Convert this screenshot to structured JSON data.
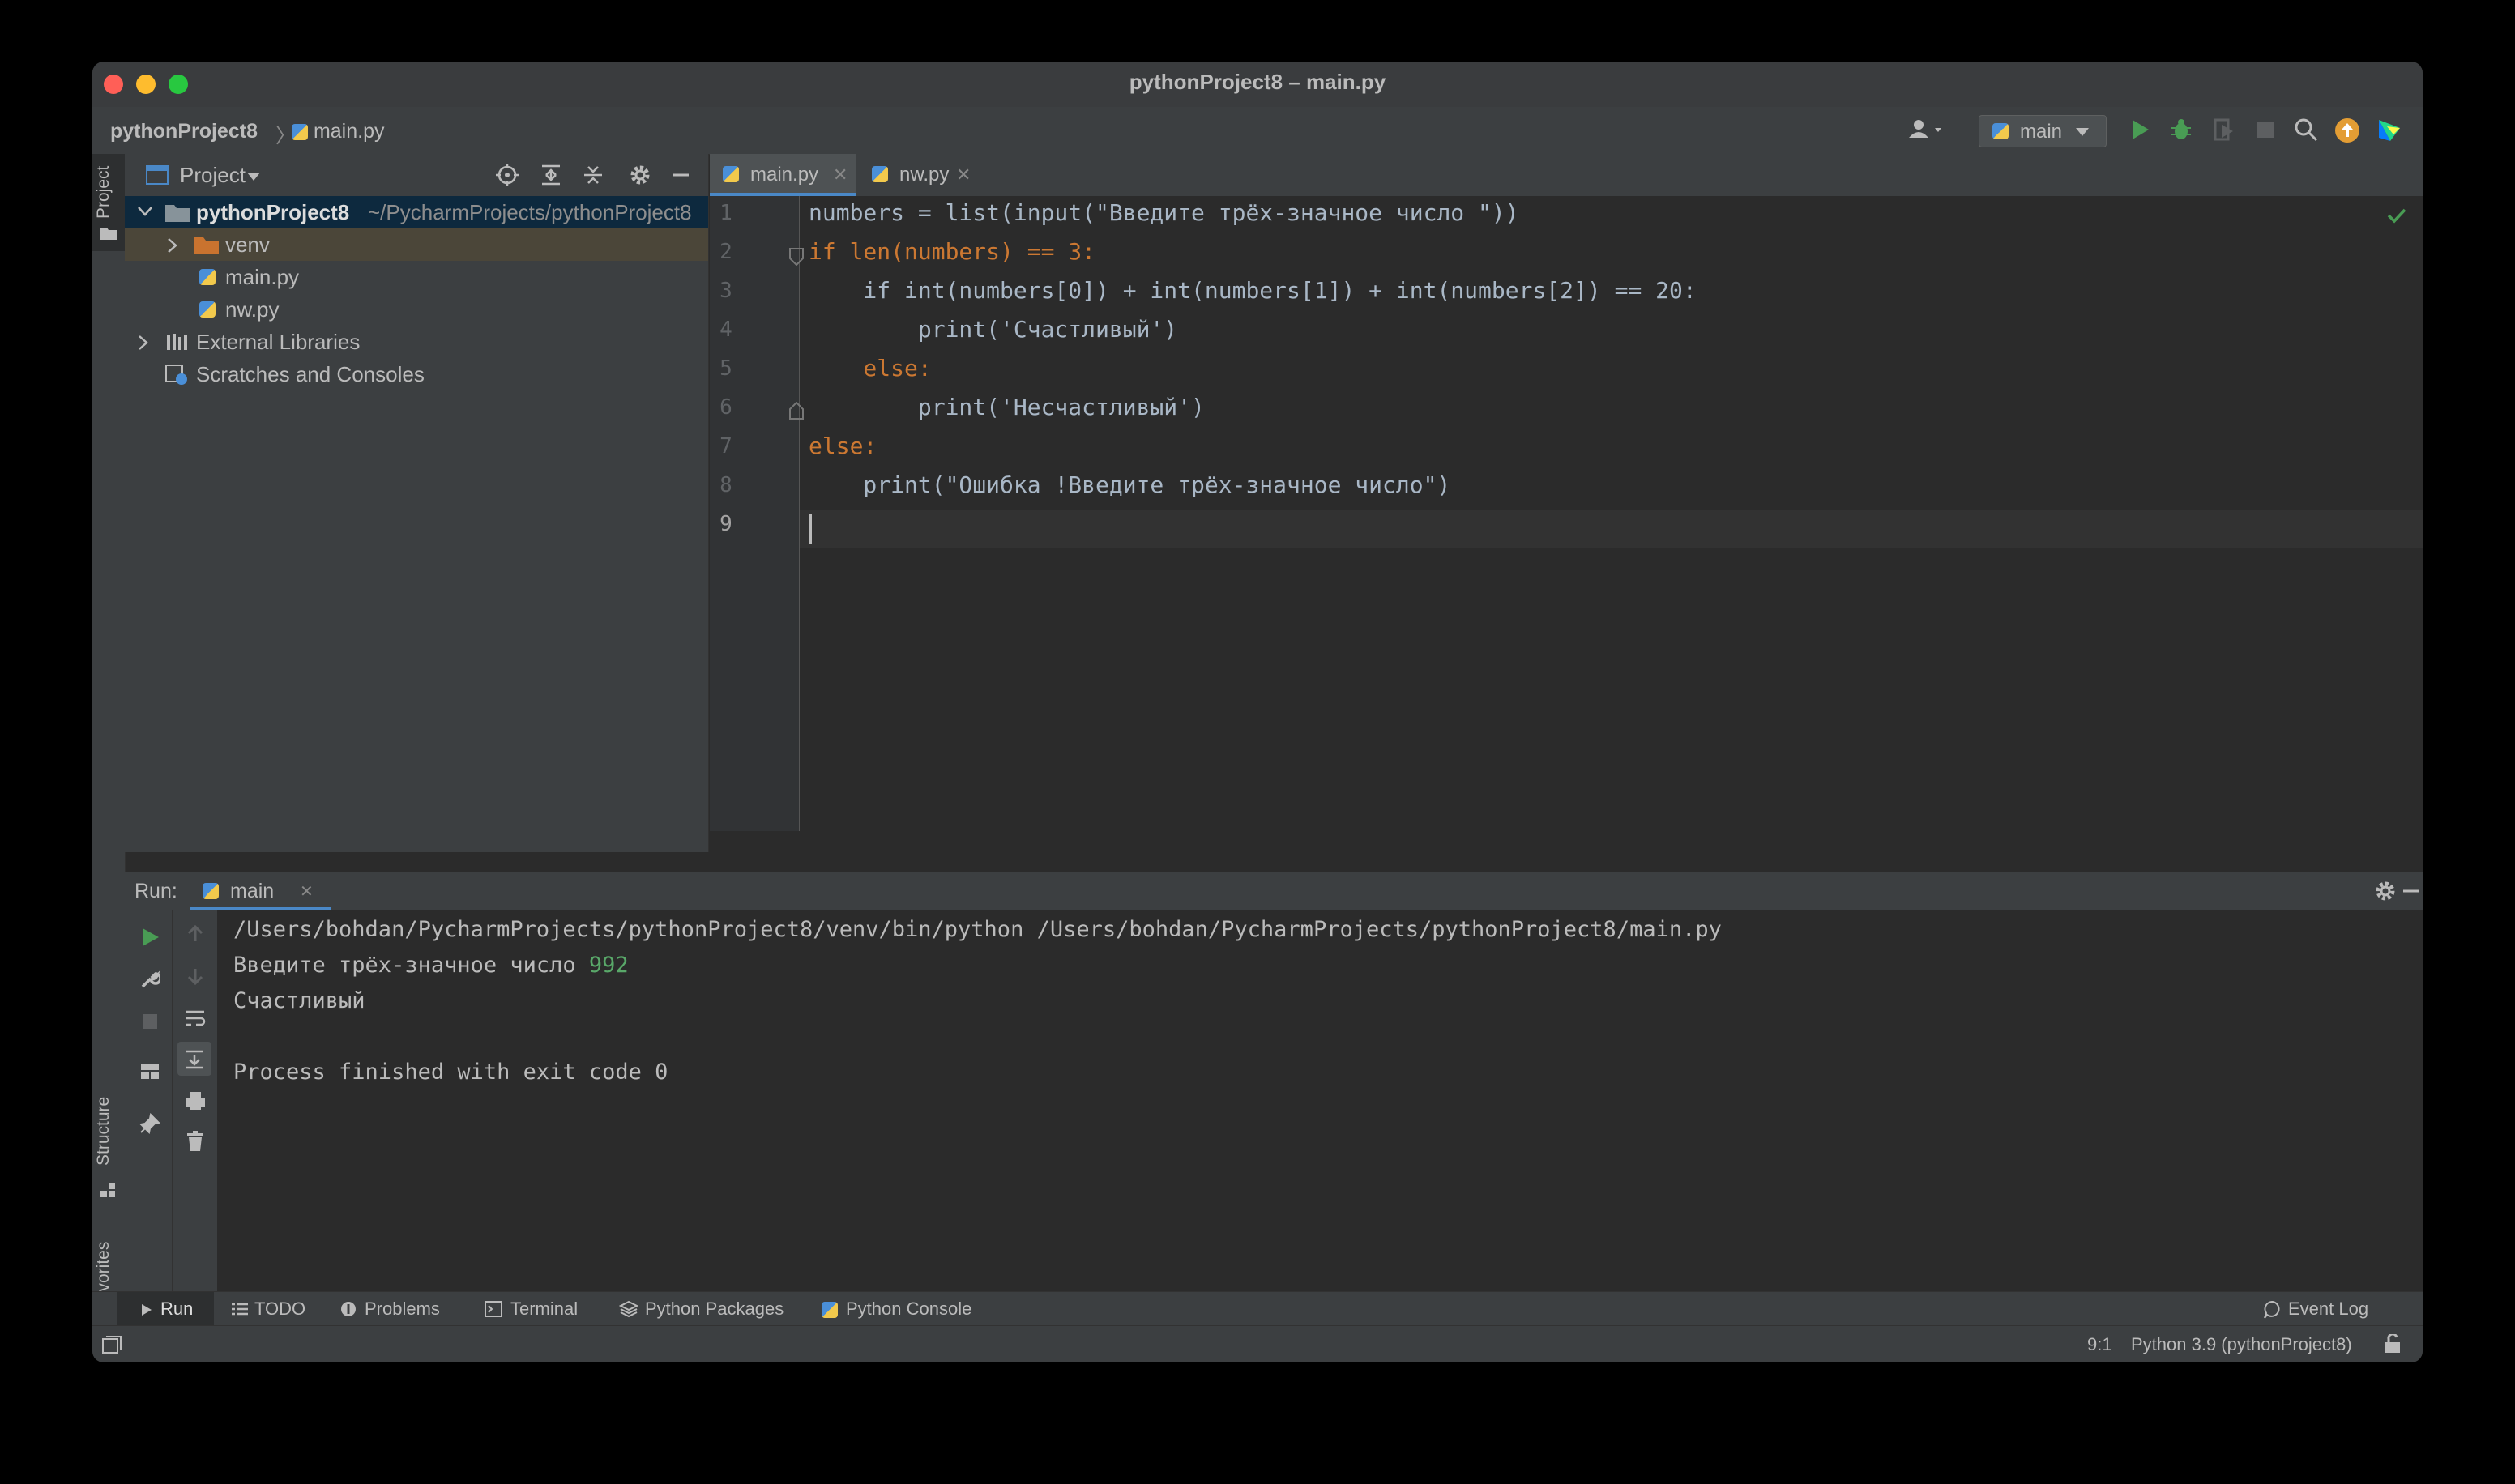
{
  "window": {
    "title": "pythonProject8 – main.py"
  },
  "nav": {
    "project": "pythonProject8",
    "separator": "〉",
    "file": "main.py",
    "run_config": "main"
  },
  "project_panel": {
    "label": "Project",
    "tree": [
      {
        "name": "pythonProject8",
        "path": "~/PycharmProjects/pythonProject8",
        "icon": "folder-icon"
      },
      {
        "name": "venv",
        "icon": "folder-icon"
      },
      {
        "name": "main.py",
        "icon": "python-file-icon"
      },
      {
        "name": "nw.py",
        "icon": "python-file-icon"
      },
      {
        "name": "External Libraries",
        "icon": "library-icon"
      },
      {
        "name": "Scratches and Consoles",
        "icon": "scratches-icon"
      }
    ]
  },
  "left_strip": {
    "project": "Project",
    "structure": "Structure",
    "favorites": "Favorites"
  },
  "editor": {
    "tabs": [
      {
        "label": "main.py",
        "active": true
      },
      {
        "label": "nw.py",
        "active": false
      }
    ],
    "line_numbers": [
      "1",
      "2",
      "3",
      "4",
      "5",
      "6",
      "7",
      "8",
      "9"
    ],
    "lines": [
      "numbers = list(input(\"Введите трёх-значное число \"))",
      "if len(numbers) == 3:",
      "    if int(numbers[0]) + int(numbers[1]) + int(numbers[2]) == 20:",
      "        print('Счастливый')",
      "    else:",
      "        print('Несчастливый')",
      "else:",
      "    print(\"Ошибка !Введите трёх-значное число\")",
      ""
    ]
  },
  "run": {
    "label": "Run:",
    "tab": "main",
    "command": "/Users/bohdan/PycharmProjects/pythonProject8/venv/bin/python /Users/bohdan/PycharmProjects/pythonProject8/main.py",
    "prompt": "Введите трёх-значное число ",
    "input": "992",
    "output": "Счастливый",
    "exit": "Process finished with exit code 0"
  },
  "tool_windows": [
    "Run",
    "TODO",
    "Problems",
    "Terminal",
    "Python Packages",
    "Python Console"
  ],
  "event_log": "Event Log",
  "status": {
    "position": "9:1",
    "interpreter": "Python 3.9 (pythonProject8)"
  },
  "colors": {
    "keyword": "#cc7832",
    "builtin": "#8888c6",
    "string": "#6a8759",
    "number": "#6897bb",
    "selection": "#0d293e"
  }
}
